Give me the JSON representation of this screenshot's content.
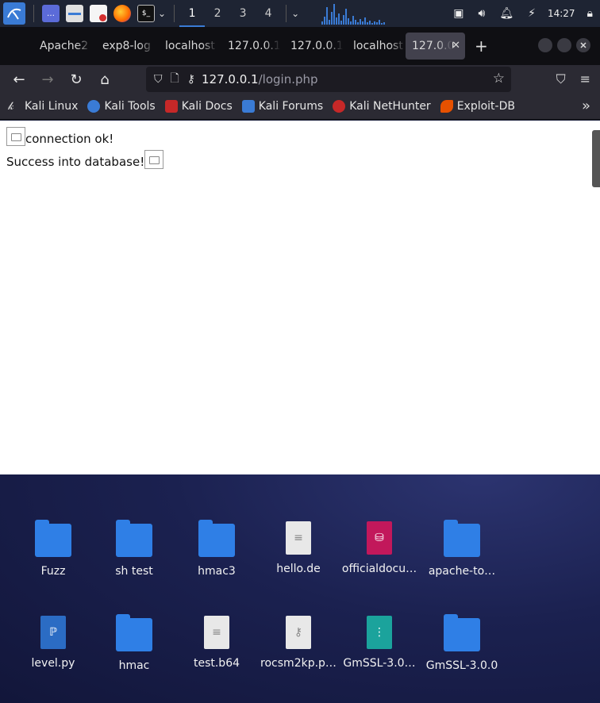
{
  "panel": {
    "workspaces": [
      "1",
      "2",
      "3",
      "4"
    ],
    "active_workspace": "1",
    "clock": "14:27"
  },
  "tabs": [
    {
      "label": "Apache2",
      "active": false
    },
    {
      "label": "exp8-log",
      "active": false
    },
    {
      "label": "localhost",
      "active": false
    },
    {
      "label": "127.0.0.1",
      "active": false
    },
    {
      "label": "127.0.0.1",
      "active": false
    },
    {
      "label": "localhost",
      "active": false
    },
    {
      "label": "127.0.0",
      "active": true
    }
  ],
  "tab_close": "✕",
  "new_tab": "+",
  "address": {
    "host": "127.0.0.1",
    "path": "/login.php"
  },
  "bookmarks": [
    {
      "label": "Kali Linux",
      "color": "#222"
    },
    {
      "label": "Kali Tools",
      "color": "#3a7bd5"
    },
    {
      "label": "Kali Docs",
      "color": "#c62828"
    },
    {
      "label": "Kali Forums",
      "color": "#3a7bd5"
    },
    {
      "label": "Kali NetHunter",
      "color": "#c62828"
    },
    {
      "label": "Exploit-DB",
      "color": "#e65100"
    }
  ],
  "page": {
    "line1": "connection ok!",
    "line2": "Success into database!"
  },
  "desktop": {
    "icons": [
      {
        "label": "Fuzz",
        "kind": "folder"
      },
      {
        "label": "sh test",
        "kind": "folder"
      },
      {
        "label": "hmac3",
        "kind": "folder"
      },
      {
        "label": "hello.de",
        "kind": "text"
      },
      {
        "label": "officialdocu…",
        "kind": "database"
      },
      {
        "label": "apache-to…",
        "kind": "folder"
      },
      {
        "label": "level.py",
        "kind": "python"
      },
      {
        "label": "hmac",
        "kind": "folder"
      },
      {
        "label": "test.b64",
        "kind": "text"
      },
      {
        "label": "rocsm2kp.p…",
        "kind": "key"
      },
      {
        "label": "GmSSL-3.0…",
        "kind": "archive"
      },
      {
        "label": "GmSSL-3.0.0",
        "kind": "folder"
      }
    ]
  },
  "colors": {
    "accent": "#3a7bd5",
    "tabbar": "#0f0f13",
    "toolbar": "#2b2a33"
  }
}
